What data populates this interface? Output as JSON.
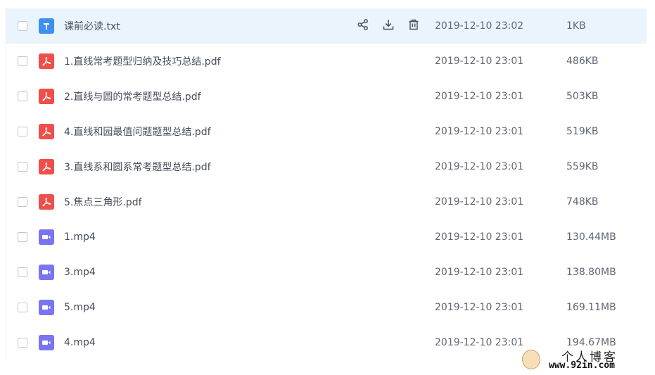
{
  "files": [
    {
      "name": "课前必读.txt",
      "type": "txt",
      "date": "2019-12-10 23:02",
      "size": "1KB",
      "hover": true
    },
    {
      "name": "1.直线常考题型归纳及技巧总结.pdf",
      "type": "pdf",
      "date": "2019-12-10 23:01",
      "size": "486KB"
    },
    {
      "name": "2.直线与圆的常考题型总结.pdf",
      "type": "pdf",
      "date": "2019-12-10 23:01",
      "size": "503KB"
    },
    {
      "name": "4.直线和园最值问题题型总结.pdf",
      "type": "pdf",
      "date": "2019-12-10 23:01",
      "size": "519KB"
    },
    {
      "name": "3.直线系和圆系常考题型总结.pdf",
      "type": "pdf",
      "date": "2019-12-10 23:01",
      "size": "559KB"
    },
    {
      "name": "5.焦点三角形.pdf",
      "type": "pdf",
      "date": "2019-12-10 23:01",
      "size": "748KB"
    },
    {
      "name": "1.mp4",
      "type": "mp4",
      "date": "2019-12-10 23:01",
      "size": "130.44MB"
    },
    {
      "name": "3.mp4",
      "type": "mp4",
      "date": "2019-12-10 23:01",
      "size": "138.80MB"
    },
    {
      "name": "5.mp4",
      "type": "mp4",
      "date": "2019-12-10 23:01",
      "size": "169.11MB"
    },
    {
      "name": "4.mp4",
      "type": "mp4",
      "date": "2019-12-10 23:01",
      "size": "194.67MB"
    }
  ],
  "row_actions": {
    "share_icon": "share-icon",
    "download_icon": "download-icon",
    "delete_icon": "trash-icon"
  },
  "watermark": {
    "title": "个人博客",
    "url": "www.92in.com"
  },
  "colors": {
    "hover_row": "#eaf4fd",
    "txt_icon": "#3f8ff0",
    "pdf_icon": "#ef4e4a",
    "mp4_icon": "#7b74f0"
  }
}
